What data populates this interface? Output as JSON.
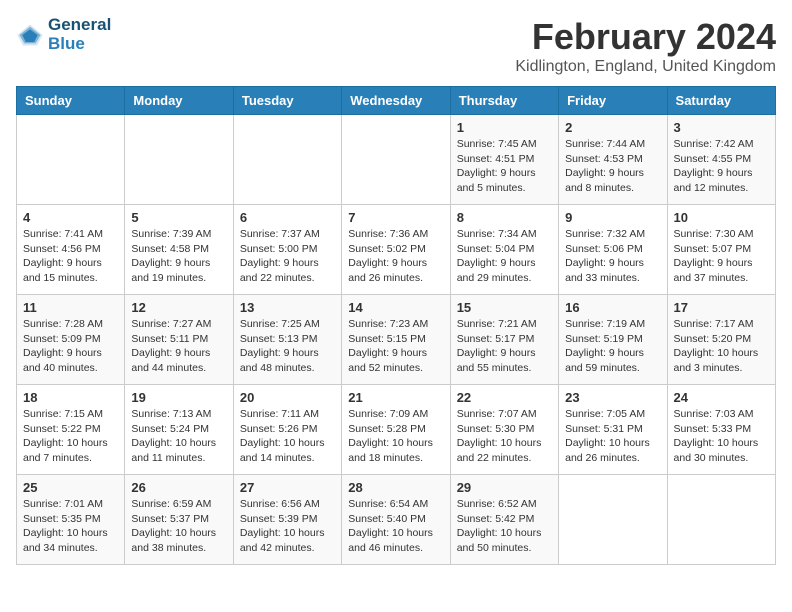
{
  "header": {
    "logo_line1": "General",
    "logo_line2": "Blue",
    "title": "February 2024",
    "subtitle": "Kidlington, England, United Kingdom"
  },
  "days_of_week": [
    "Sunday",
    "Monday",
    "Tuesday",
    "Wednesday",
    "Thursday",
    "Friday",
    "Saturday"
  ],
  "weeks": [
    [
      {
        "day": "",
        "info": ""
      },
      {
        "day": "",
        "info": ""
      },
      {
        "day": "",
        "info": ""
      },
      {
        "day": "",
        "info": ""
      },
      {
        "day": "1",
        "info": "Sunrise: 7:45 AM\nSunset: 4:51 PM\nDaylight: 9 hours\nand 5 minutes."
      },
      {
        "day": "2",
        "info": "Sunrise: 7:44 AM\nSunset: 4:53 PM\nDaylight: 9 hours\nand 8 minutes."
      },
      {
        "day": "3",
        "info": "Sunrise: 7:42 AM\nSunset: 4:55 PM\nDaylight: 9 hours\nand 12 minutes."
      }
    ],
    [
      {
        "day": "4",
        "info": "Sunrise: 7:41 AM\nSunset: 4:56 PM\nDaylight: 9 hours\nand 15 minutes."
      },
      {
        "day": "5",
        "info": "Sunrise: 7:39 AM\nSunset: 4:58 PM\nDaylight: 9 hours\nand 19 minutes."
      },
      {
        "day": "6",
        "info": "Sunrise: 7:37 AM\nSunset: 5:00 PM\nDaylight: 9 hours\nand 22 minutes."
      },
      {
        "day": "7",
        "info": "Sunrise: 7:36 AM\nSunset: 5:02 PM\nDaylight: 9 hours\nand 26 minutes."
      },
      {
        "day": "8",
        "info": "Sunrise: 7:34 AM\nSunset: 5:04 PM\nDaylight: 9 hours\nand 29 minutes."
      },
      {
        "day": "9",
        "info": "Sunrise: 7:32 AM\nSunset: 5:06 PM\nDaylight: 9 hours\nand 33 minutes."
      },
      {
        "day": "10",
        "info": "Sunrise: 7:30 AM\nSunset: 5:07 PM\nDaylight: 9 hours\nand 37 minutes."
      }
    ],
    [
      {
        "day": "11",
        "info": "Sunrise: 7:28 AM\nSunset: 5:09 PM\nDaylight: 9 hours\nand 40 minutes."
      },
      {
        "day": "12",
        "info": "Sunrise: 7:27 AM\nSunset: 5:11 PM\nDaylight: 9 hours\nand 44 minutes."
      },
      {
        "day": "13",
        "info": "Sunrise: 7:25 AM\nSunset: 5:13 PM\nDaylight: 9 hours\nand 48 minutes."
      },
      {
        "day": "14",
        "info": "Sunrise: 7:23 AM\nSunset: 5:15 PM\nDaylight: 9 hours\nand 52 minutes."
      },
      {
        "day": "15",
        "info": "Sunrise: 7:21 AM\nSunset: 5:17 PM\nDaylight: 9 hours\nand 55 minutes."
      },
      {
        "day": "16",
        "info": "Sunrise: 7:19 AM\nSunset: 5:19 PM\nDaylight: 9 hours\nand 59 minutes."
      },
      {
        "day": "17",
        "info": "Sunrise: 7:17 AM\nSunset: 5:20 PM\nDaylight: 10 hours\nand 3 minutes."
      }
    ],
    [
      {
        "day": "18",
        "info": "Sunrise: 7:15 AM\nSunset: 5:22 PM\nDaylight: 10 hours\nand 7 minutes."
      },
      {
        "day": "19",
        "info": "Sunrise: 7:13 AM\nSunset: 5:24 PM\nDaylight: 10 hours\nand 11 minutes."
      },
      {
        "day": "20",
        "info": "Sunrise: 7:11 AM\nSunset: 5:26 PM\nDaylight: 10 hours\nand 14 minutes."
      },
      {
        "day": "21",
        "info": "Sunrise: 7:09 AM\nSunset: 5:28 PM\nDaylight: 10 hours\nand 18 minutes."
      },
      {
        "day": "22",
        "info": "Sunrise: 7:07 AM\nSunset: 5:30 PM\nDaylight: 10 hours\nand 22 minutes."
      },
      {
        "day": "23",
        "info": "Sunrise: 7:05 AM\nSunset: 5:31 PM\nDaylight: 10 hours\nand 26 minutes."
      },
      {
        "day": "24",
        "info": "Sunrise: 7:03 AM\nSunset: 5:33 PM\nDaylight: 10 hours\nand 30 minutes."
      }
    ],
    [
      {
        "day": "25",
        "info": "Sunrise: 7:01 AM\nSunset: 5:35 PM\nDaylight: 10 hours\nand 34 minutes."
      },
      {
        "day": "26",
        "info": "Sunrise: 6:59 AM\nSunset: 5:37 PM\nDaylight: 10 hours\nand 38 minutes."
      },
      {
        "day": "27",
        "info": "Sunrise: 6:56 AM\nSunset: 5:39 PM\nDaylight: 10 hours\nand 42 minutes."
      },
      {
        "day": "28",
        "info": "Sunrise: 6:54 AM\nSunset: 5:40 PM\nDaylight: 10 hours\nand 46 minutes."
      },
      {
        "day": "29",
        "info": "Sunrise: 6:52 AM\nSunset: 5:42 PM\nDaylight: 10 hours\nand 50 minutes."
      },
      {
        "day": "",
        "info": ""
      },
      {
        "day": "",
        "info": ""
      }
    ]
  ]
}
